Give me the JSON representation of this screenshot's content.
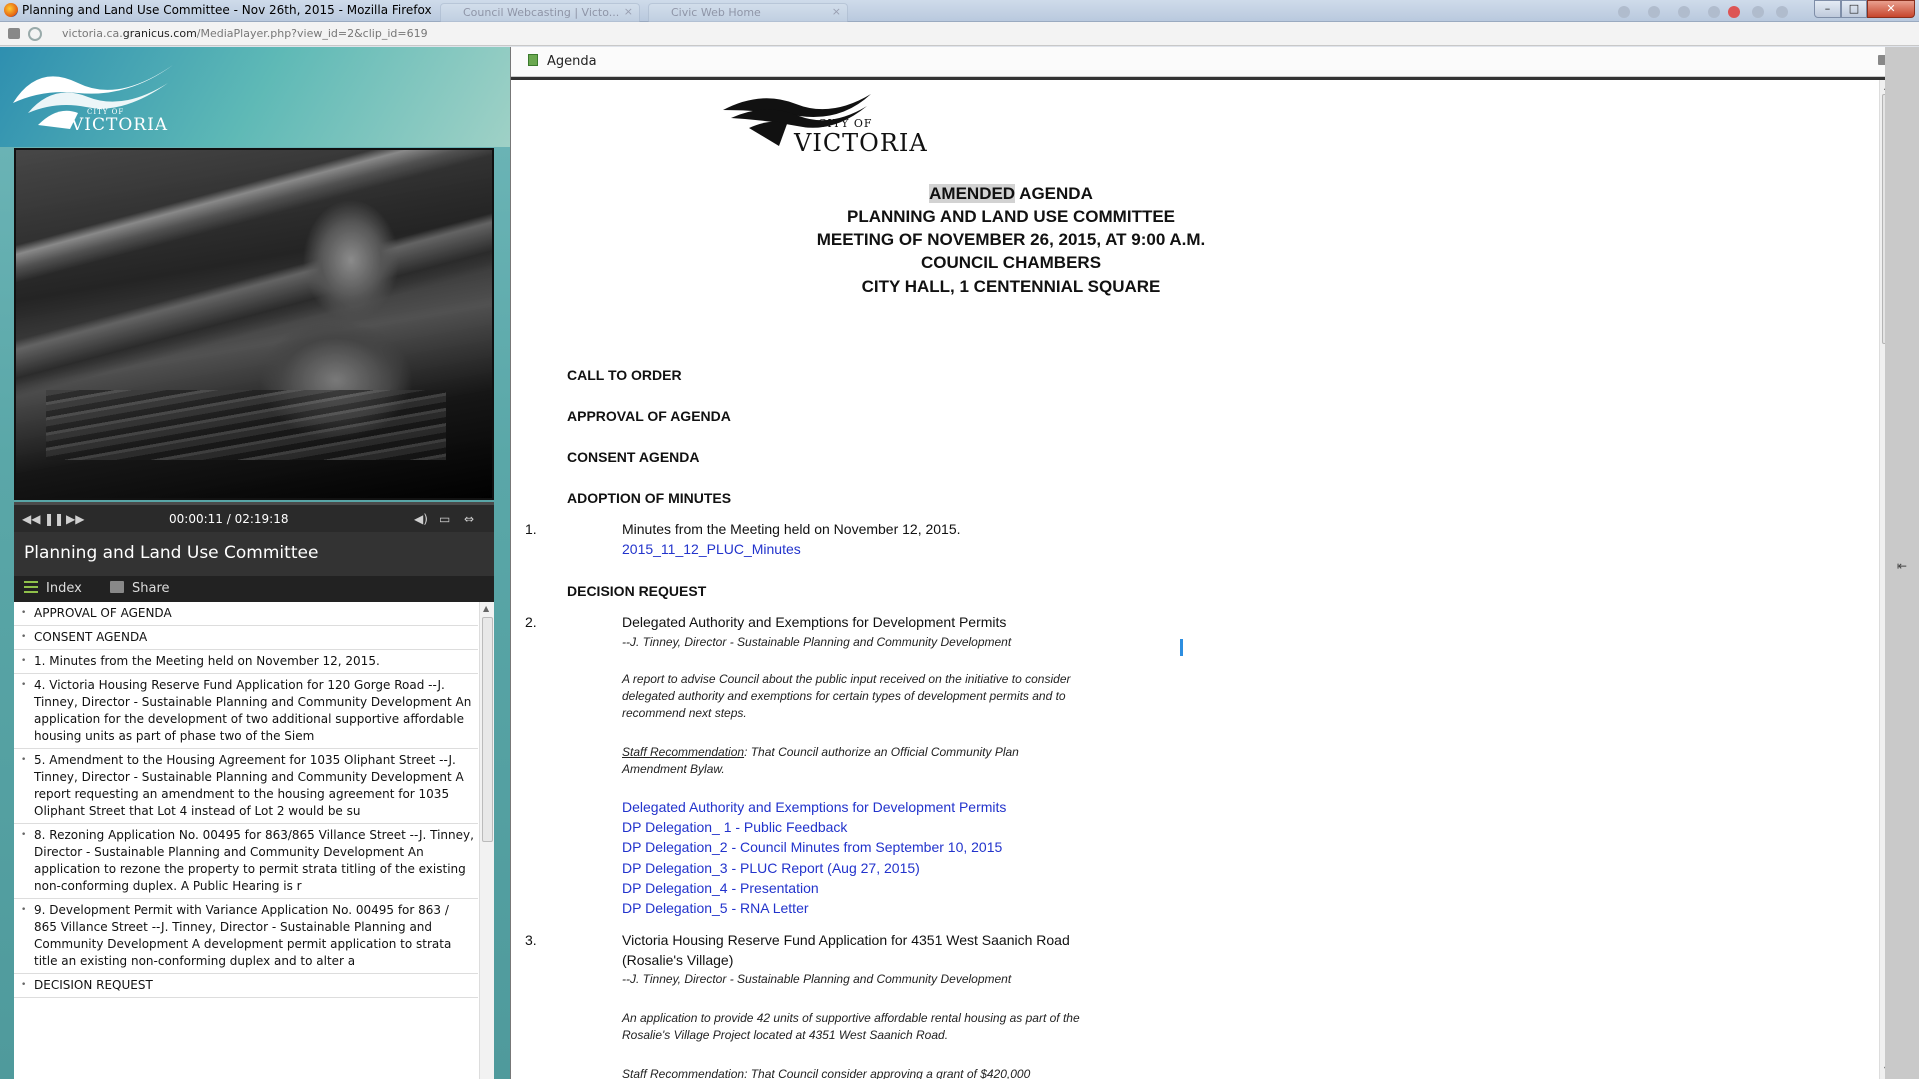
{
  "browser": {
    "window_title": "Planning and Land Use Committee - Nov 26th, 2015 - Mozilla Firefox",
    "tabs": [
      "Council Webcasting | Victo...",
      "Civic Web Home"
    ],
    "url_prefix": "victoria.ca.",
    "url_domain": "granicus.com",
    "url_path": "/MediaPlayer.php?view_id=2&clip_id=619",
    "controls": {
      "minimize": "–",
      "maximize": "□",
      "close": "✕"
    }
  },
  "left": {
    "logo": {
      "city": "CITY OF",
      "name": "VICTORIA"
    },
    "player": {
      "time": "00:00:11 / 02:19:18",
      "progress": 0.0013
    },
    "meeting_title": "Planning and Land Use Committee",
    "tabs": {
      "index": "Index",
      "share": "Share"
    },
    "index_items": [
      "APPROVAL OF AGENDA",
      "CONSENT AGENDA",
      "1. Minutes from the Meeting held on November 12, 2015.",
      "4. Victoria Housing Reserve Fund Application for 120 Gorge Road --J. Tinney, Director - Sustainable Planning and Community Development An application for the development of two additional supportive affordable housing units as part of phase two of the Siem",
      "5. Amendment to the Housing Agreement for 1035 Oliphant Street --J. Tinney, Director - Sustainable Planning and Community Development A report requesting an amendment to the housing agreement for 1035 Oliphant Street that Lot 4 instead of Lot 2 would be su",
      "8. Rezoning Application No. 00495 for 863/865 Villance Street --J. Tinney, Director - Sustainable Planning and Community Development An application to rezone the property to permit strata titling of the existing non-conforming duplex. A Public Hearing is r",
      "9. Development Permit with Variance Application No. 00495 for 863 / 865 Villance Street --J. Tinney, Director - Sustainable Planning and Community Development A development permit application to strata title an existing non-conforming duplex and to alter a",
      "DECISION REQUEST"
    ]
  },
  "agenda": {
    "panel_label": "Agenda",
    "logo": {
      "city": "CITY OF",
      "name": "VICTORIA"
    },
    "heading": {
      "amended": "AMENDED",
      "line1_rest": " AGENDA",
      "line2": "PLANNING AND LAND USE COMMITTEE",
      "line3": "MEETING OF NOVEMBER 26, 2015, AT 9:00 A.M.",
      "line4": "COUNCIL CHAMBERS",
      "line5": "CITY HALL, 1 CENTENNIAL SQUARE"
    },
    "sections": {
      "call_to_order": "CALL TO ORDER",
      "approval": "APPROVAL OF AGENDA",
      "consent": "CONSENT AGENDA",
      "minutes": "ADOPTION OF MINUTES",
      "decision": "DECISION REQUEST"
    },
    "item1": {
      "num": "1.",
      "title": "Minutes from the Meeting held on November 12, 2015.",
      "link": "2015_11_12_PLUC_Minutes"
    },
    "item2": {
      "num": "2.",
      "title": "Delegated Authority and Exemptions for Development Permits",
      "by": "--J. Tinney, Director - Sustainable Planning and Community Development",
      "desc": "A report to advise Council about the public input received on the initiative to consider delegated authority and exemptions for certain types of development permits and to recommend next steps.",
      "rec_label": "Staff Recommendation",
      "rec_text": ": That Council authorize an Official Community Plan Amendment Bylaw.",
      "links": [
        "Delegated Authority and Exemptions for Development Permits",
        "DP Delegation_ 1 - Public Feedback",
        "DP Delegation_2 - Council Minutes from September 10, 2015",
        "DP Delegation_3 - PLUC Report (Aug 27, 2015)",
        "DP Delegation_4 - Presentation",
        "DP Delegation_5 - RNA Letter"
      ]
    },
    "item3": {
      "num": "3.",
      "title": "Victoria Housing Reserve Fund Application for 4351 West Saanich Road (Rosalie's Village)",
      "by": "--J. Tinney, Director - Sustainable Planning and Community Development",
      "desc": "An application to provide 42 units of supportive affordable rental housing as part of the Rosalie's Village Project located at 4351 West Saanich Road.",
      "rec_partial": "Staff Recommendation: That Council consider approving a grant of $420,000"
    }
  }
}
